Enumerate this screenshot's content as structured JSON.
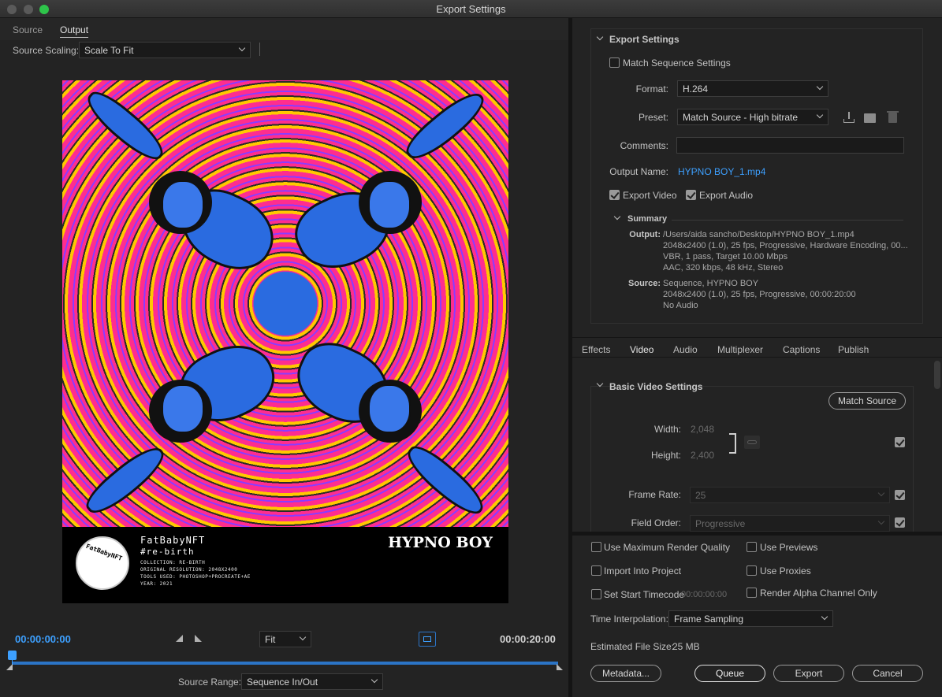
{
  "window": {
    "title": "Export Settings"
  },
  "left": {
    "tabs": [
      "Source",
      "Output"
    ],
    "source_scaling_label": "Source Scaling:",
    "source_scaling_value": "Scale To Fit",
    "preview": {
      "brand": "FatBabyNFT",
      "hashtag": "#re-birth",
      "badge_text": "FatBabyNFT",
      "meta": [
        "COLLECTION: RE-BIRTH",
        "ORIGINAL RESOLUTION: 2048X2400",
        "TOOLS USED: PHOTOSHOP+PROCREATE+AE",
        "YEAR: 2021"
      ],
      "title": "HYPNO BOY"
    },
    "timecode_start": "00:00:00:00",
    "timecode_end": "00:00:20:00",
    "zoom": "Fit",
    "source_range_label": "Source Range:",
    "source_range_value": "Sequence In/Out"
  },
  "export_settings": {
    "title": "Export Settings",
    "match_sequence": "Match Sequence Settings",
    "format_label": "Format:",
    "format_value": "H.264",
    "preset_label": "Preset:",
    "preset_value": "Match Source - High bitrate",
    "comments_label": "Comments:",
    "output_name_label": "Output Name:",
    "output_name_value": "HYPNO BOY_1.mp4",
    "export_video": "Export Video",
    "export_audio": "Export Audio",
    "summary_title": "Summary",
    "output_key": "Output:",
    "output_lines": [
      "/Users/aida sancho/Desktop/HYPNO BOY_1.mp4",
      "2048x2400 (1.0), 25 fps, Progressive, Hardware Encoding, 00...",
      "VBR, 1 pass, Target 10.00 Mbps",
      "AAC, 320 kbps, 48 kHz, Stereo"
    ],
    "source_key": "Source:",
    "source_lines": [
      "Sequence, HYPNO BOY",
      "2048x2400 (1.0), 25 fps, Progressive, 00:00:20:00",
      "No Audio"
    ]
  },
  "settings_tabs": [
    "Effects",
    "Video",
    "Audio",
    "Multiplexer",
    "Captions",
    "Publish"
  ],
  "video": {
    "section_title": "Basic Video Settings",
    "match_source": "Match Source",
    "width_label": "Width:",
    "width_value": "2,048",
    "height_label": "Height:",
    "height_value": "2,400",
    "frame_rate_label": "Frame Rate:",
    "frame_rate_value": "25",
    "field_order_label": "Field Order:",
    "field_order_value": "Progressive"
  },
  "bottom": {
    "max_render": "Use Maximum Render Quality",
    "use_previews": "Use Previews",
    "import_project": "Import Into Project",
    "use_proxies": "Use Proxies",
    "set_start_tc": "Set Start Timecode",
    "start_tc_value": "00:00:00:00",
    "render_alpha": "Render Alpha Channel Only",
    "time_interp_label": "Time Interpolation:",
    "time_interp_value": "Frame Sampling",
    "est_size_label": "Estimated File Size:",
    "est_size_value": "25 MB",
    "buttons": {
      "metadata": "Metadata...",
      "queue": "Queue",
      "export": "Export",
      "cancel": "Cancel"
    }
  },
  "colors": {
    "accent": "#3da0ff",
    "panel": "#232323"
  }
}
